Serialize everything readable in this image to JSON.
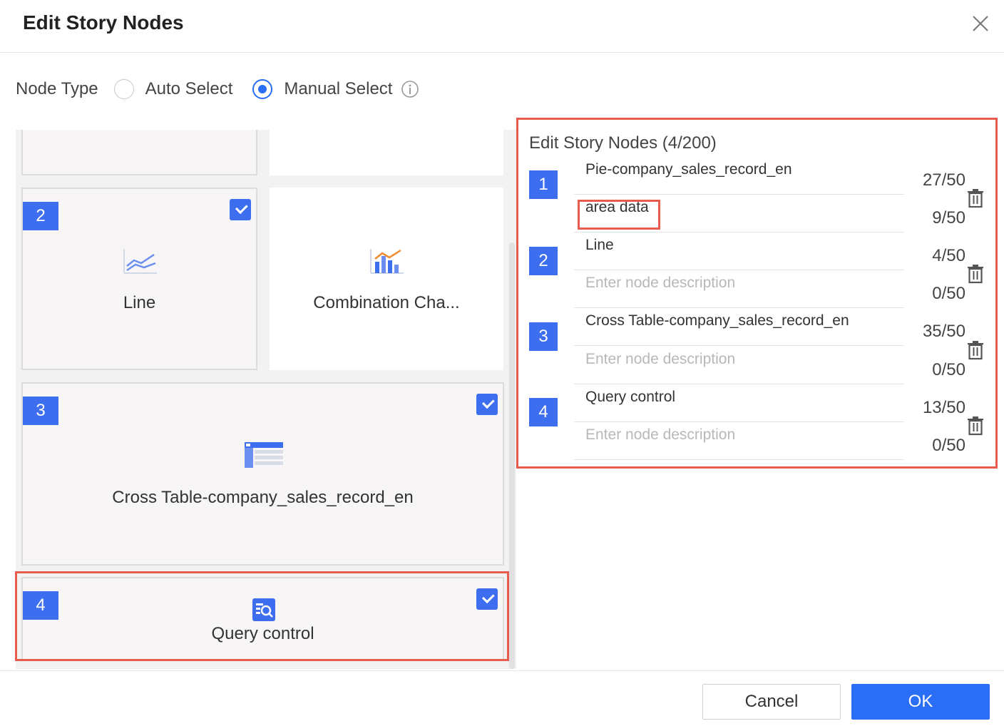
{
  "dialog": {
    "title": "Edit Story Nodes"
  },
  "node_type": {
    "label": "Node Type",
    "options": [
      {
        "label": "Auto Select",
        "checked": false
      },
      {
        "label": "Manual Select",
        "checked": true
      }
    ]
  },
  "cards": [
    {
      "badge": "",
      "label": "",
      "icon": "none",
      "checked": false
    },
    {
      "badge": "",
      "label": "",
      "icon": "none",
      "checked": false
    },
    {
      "badge": "2",
      "label": "Line",
      "icon": "line-chart-icon",
      "checked": true
    },
    {
      "badge": "",
      "label": "Combination Cha...",
      "icon": "combination-chart-icon",
      "checked": false
    },
    {
      "badge": "3",
      "label": "Cross Table-company_sales_record_en",
      "icon": "cross-table-icon",
      "checked": true
    },
    {
      "badge": "4",
      "label": "Query control",
      "icon": "query-control-icon",
      "checked": true
    }
  ],
  "story_nodes": {
    "title": "Edit Story Nodes (4/200)",
    "nodes": [
      {
        "num": "1",
        "name": "Pie-company_sales_record_en",
        "name_count": "27/50",
        "description": "area data",
        "description_placeholder": "Enter node description",
        "desc_count": "9/50"
      },
      {
        "num": "2",
        "name": "Line",
        "name_count": "4/50",
        "description": "",
        "description_placeholder": "Enter node description",
        "desc_count": "0/50"
      },
      {
        "num": "3",
        "name": "Cross Table-company_sales_record_en",
        "name_count": "35/50",
        "description": "",
        "description_placeholder": "Enter node description",
        "desc_count": "0/50"
      },
      {
        "num": "4",
        "name": "Query control",
        "name_count": "13/50",
        "description": "",
        "description_placeholder": "Enter node description",
        "desc_count": "0/50"
      }
    ]
  },
  "footer": {
    "cancel_label": "Cancel",
    "ok_label": "OK"
  },
  "colors": {
    "accent": "#2a6ef5",
    "badge": "#3d6ef0",
    "highlight": "#e85b4f"
  }
}
